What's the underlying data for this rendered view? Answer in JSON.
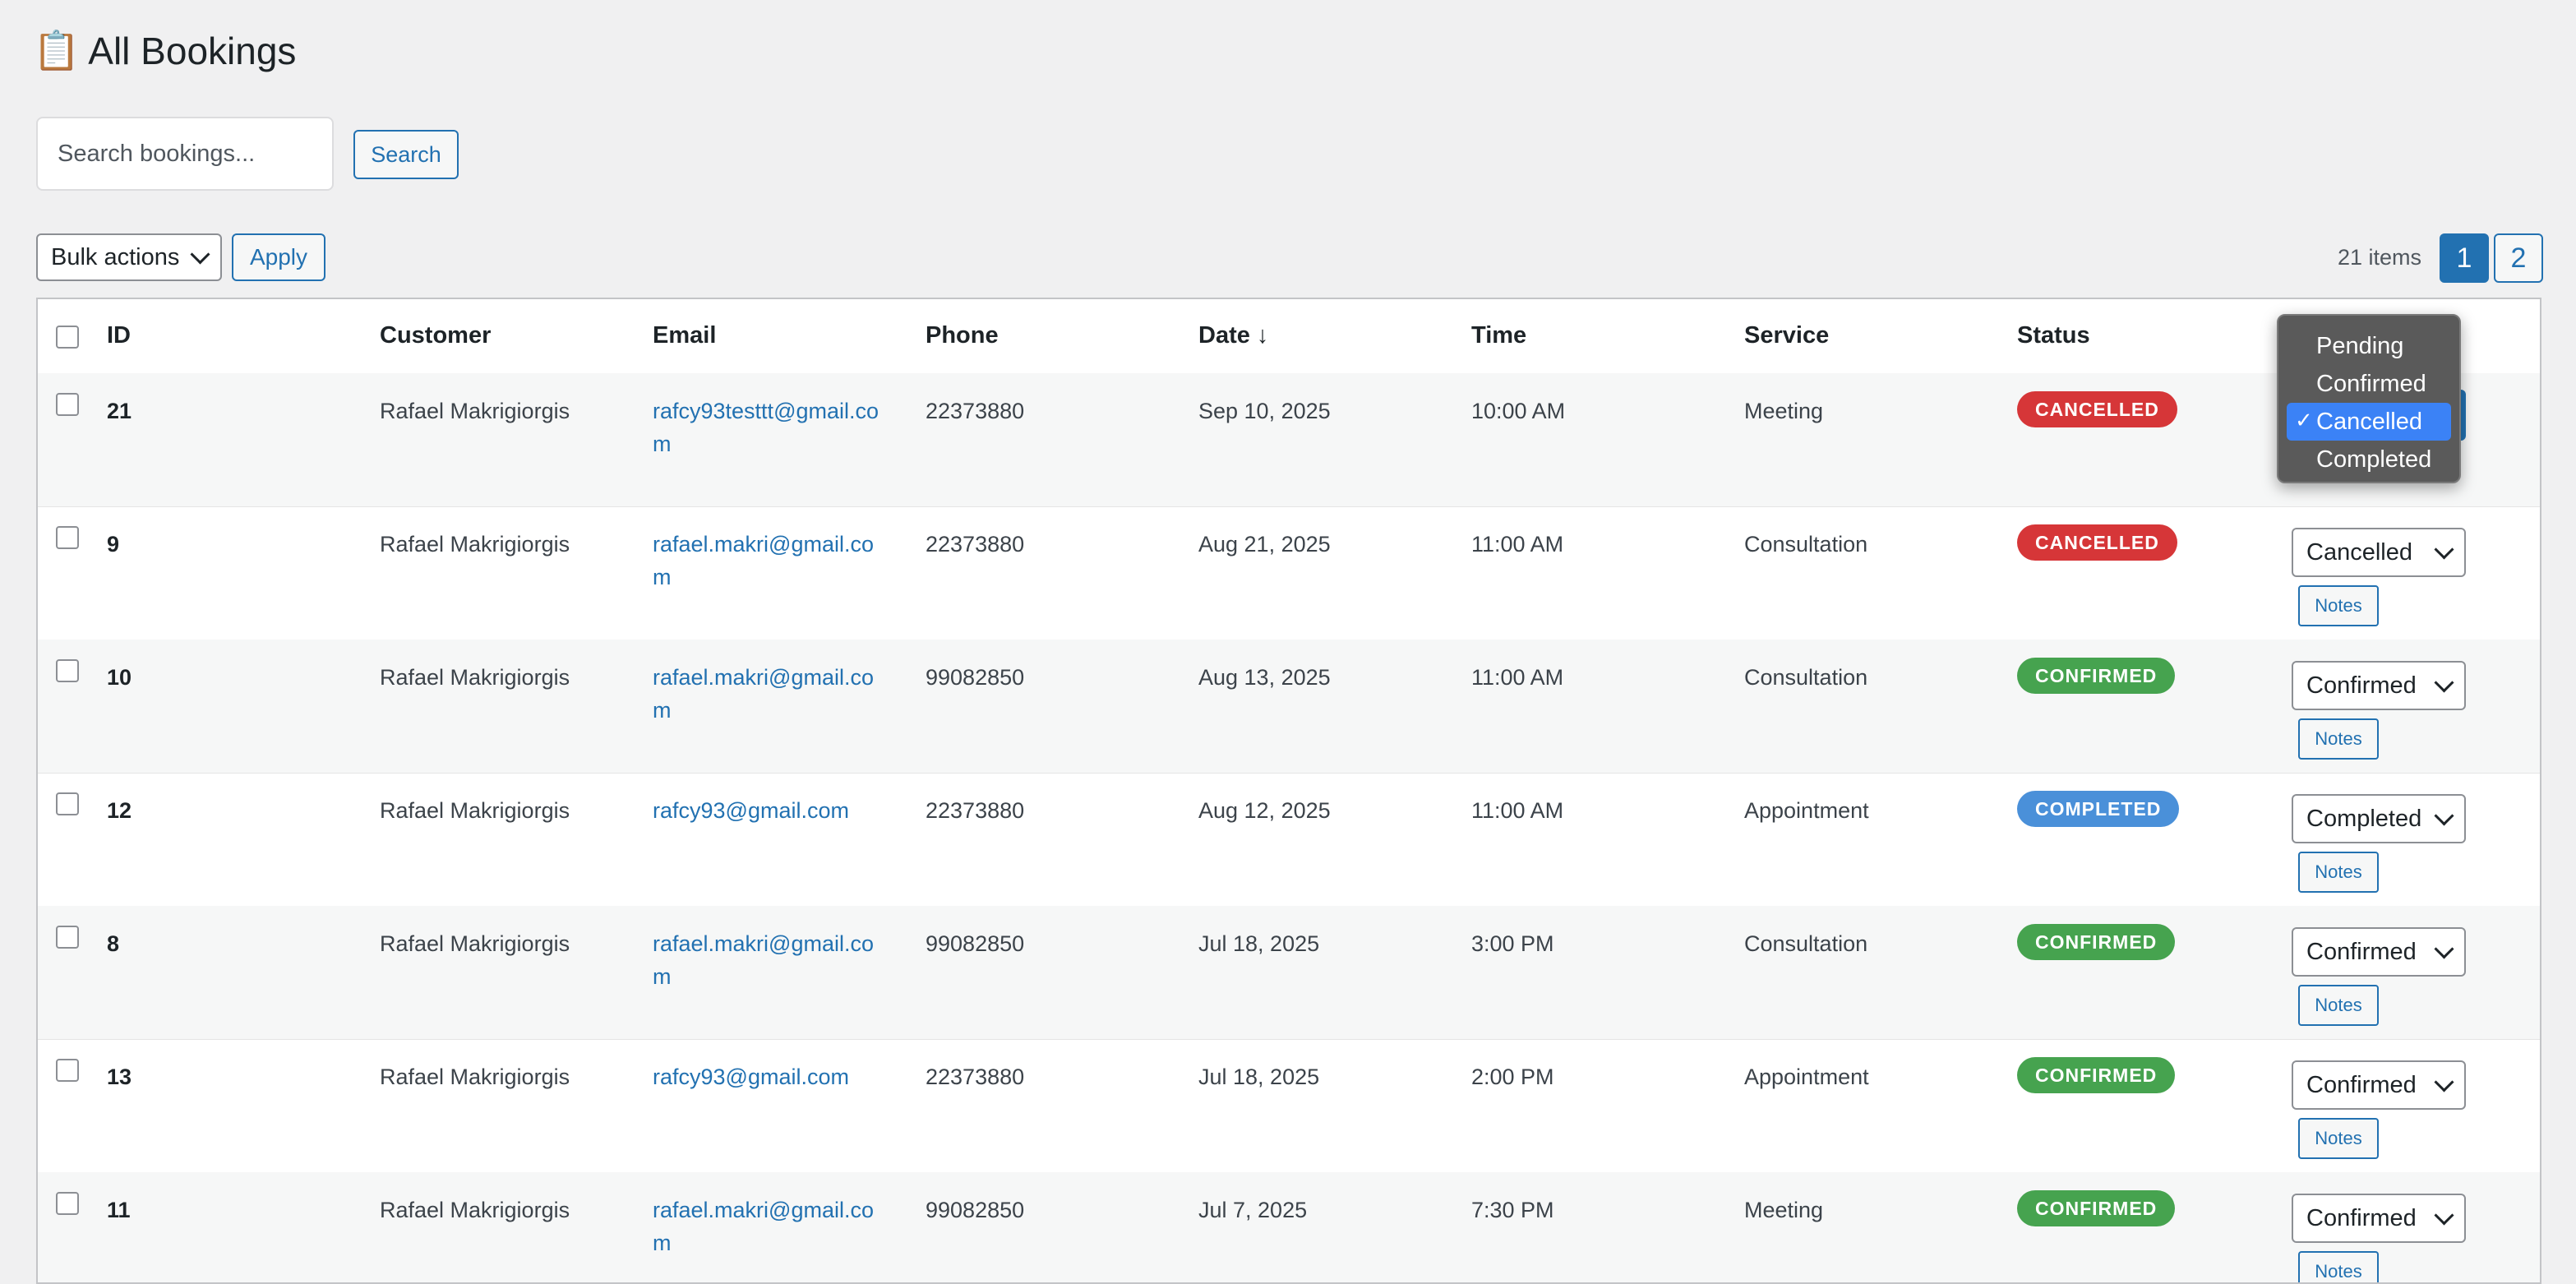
{
  "page": {
    "title_icon": "📋",
    "title": "All Bookings"
  },
  "search": {
    "placeholder": "Search bookings...",
    "value": "",
    "button_label": "Search"
  },
  "toolbar": {
    "bulk_actions_label": "Bulk actions",
    "apply_label": "Apply",
    "items_count": "21 items",
    "pages": [
      "1",
      "2"
    ],
    "current_page": "1"
  },
  "table": {
    "headers": {
      "id": "ID",
      "customer": "Customer",
      "email": "Email",
      "phone": "Phone",
      "date": "Date ↓",
      "time": "Time",
      "service": "Service",
      "status": "Status"
    },
    "notes_label": "Notes",
    "rows": [
      {
        "id": "21",
        "customer": "Rafael Makrigiorgis",
        "email": "rafcy93testtt@gmail.com",
        "phone": "22373880",
        "date": "Sep 10, 2025",
        "time": "10:00 AM",
        "service": "Meeting",
        "status_badge": "CANCELLED",
        "status_value": "Cancelled"
      },
      {
        "id": "9",
        "customer": "Rafael Makrigiorgis",
        "email": "rafael.makri@gmail.com",
        "phone": "22373880",
        "date": "Aug 21, 2025",
        "time": "11:00 AM",
        "service": "Consultation",
        "status_badge": "CANCELLED",
        "status_value": "Cancelled"
      },
      {
        "id": "10",
        "customer": "Rafael Makrigiorgis",
        "email": "rafael.makri@gmail.com",
        "phone": "99082850",
        "date": "Aug 13, 2025",
        "time": "11:00 AM",
        "service": "Consultation",
        "status_badge": "CONFIRMED",
        "status_value": "Confirmed"
      },
      {
        "id": "12",
        "customer": "Rafael Makrigiorgis",
        "email": "rafcy93@gmail.com",
        "phone": "22373880",
        "date": "Aug 12, 2025",
        "time": "11:00 AM",
        "service": "Appointment",
        "status_badge": "COMPLETED",
        "status_value": "Completed"
      },
      {
        "id": "8",
        "customer": "Rafael Makrigiorgis",
        "email": "rafael.makri@gmail.com",
        "phone": "99082850",
        "date": "Jul 18, 2025",
        "time": "3:00 PM",
        "service": "Consultation",
        "status_badge": "CONFIRMED",
        "status_value": "Confirmed"
      },
      {
        "id": "13",
        "customer": "Rafael Makrigiorgis",
        "email": "rafcy93@gmail.com",
        "phone": "22373880",
        "date": "Jul 18, 2025",
        "time": "2:00 PM",
        "service": "Appointment",
        "status_badge": "CONFIRMED",
        "status_value": "Confirmed"
      },
      {
        "id": "11",
        "customer": "Rafael Makrigiorgis",
        "email": "rafael.makri@gmail.com",
        "phone": "99082850",
        "date": "Jul 7, 2025",
        "time": "7:30 PM",
        "service": "Meeting",
        "status_badge": "CONFIRMED",
        "status_value": "Confirmed"
      }
    ]
  },
  "status_dropdown": {
    "options": [
      "Pending",
      "Confirmed",
      "Cancelled",
      "Completed"
    ],
    "selected": "Cancelled",
    "check_glyph": "✓"
  },
  "colors": {
    "CANCELLED": "#d63638",
    "CONFIRMED": "#46a34f",
    "COMPLETED": "#4a90d9",
    "accent": "#2271b1"
  }
}
